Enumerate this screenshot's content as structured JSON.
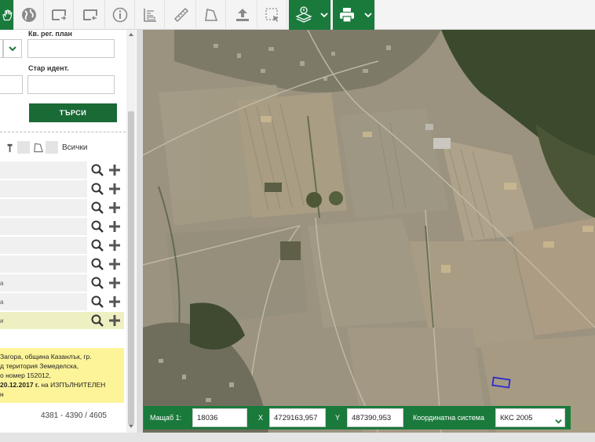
{
  "colors": {
    "accent": "#1a7a3c",
    "highlight": "#fdf49a"
  },
  "toolbar": {
    "buttons": [
      {
        "name": "pan-hand-icon",
        "active": true
      },
      {
        "name": "globe-icon"
      },
      {
        "name": "map-frame-icon"
      },
      {
        "name": "map-frame-out-icon"
      },
      {
        "name": "info-icon"
      },
      {
        "name": "measure-area-icon"
      },
      {
        "name": "ruler-icon"
      },
      {
        "name": "polygon-icon"
      },
      {
        "name": "upload-icon"
      },
      {
        "name": "select-region-icon"
      },
      {
        "name": "layers-info-icon"
      },
      {
        "name": "print-icon"
      }
    ]
  },
  "form": {
    "kv_reg_plan_label": "Кв. рег. план",
    "star_ident_label": "Стар идент.",
    "search_label": "ТЪРСИ"
  },
  "filters": {
    "all_label": "Всички"
  },
  "results": {
    "rows": [
      {
        "text": ""
      },
      {
        "text": ""
      },
      {
        "text": ""
      },
      {
        "text": ""
      },
      {
        "text": ""
      },
      {
        "text": ""
      },
      {
        "text": "а"
      },
      {
        "text": "а"
      },
      {
        "text": "и"
      }
    ]
  },
  "info": {
    "line1": "Загора, община Казанлък, гр.",
    "line2": "д територия Земеделска,",
    "line3": "о номер 152012,",
    "line4_bold": "20.12.2017 г.",
    "line4_rest": " на ИЗПЪЛНИТЕЛЕН",
    "line5": "н"
  },
  "pager": {
    "range": "4381 - 4390 / 4605"
  },
  "coords": {
    "scale_label": "Мащаб  1:",
    "scale_value": "18036",
    "x_label": "X",
    "x_value": "4729163,957",
    "y_label": "Y",
    "y_value": "487390,953",
    "system_label": "Координатна система",
    "system_value": "ККС 2005"
  }
}
